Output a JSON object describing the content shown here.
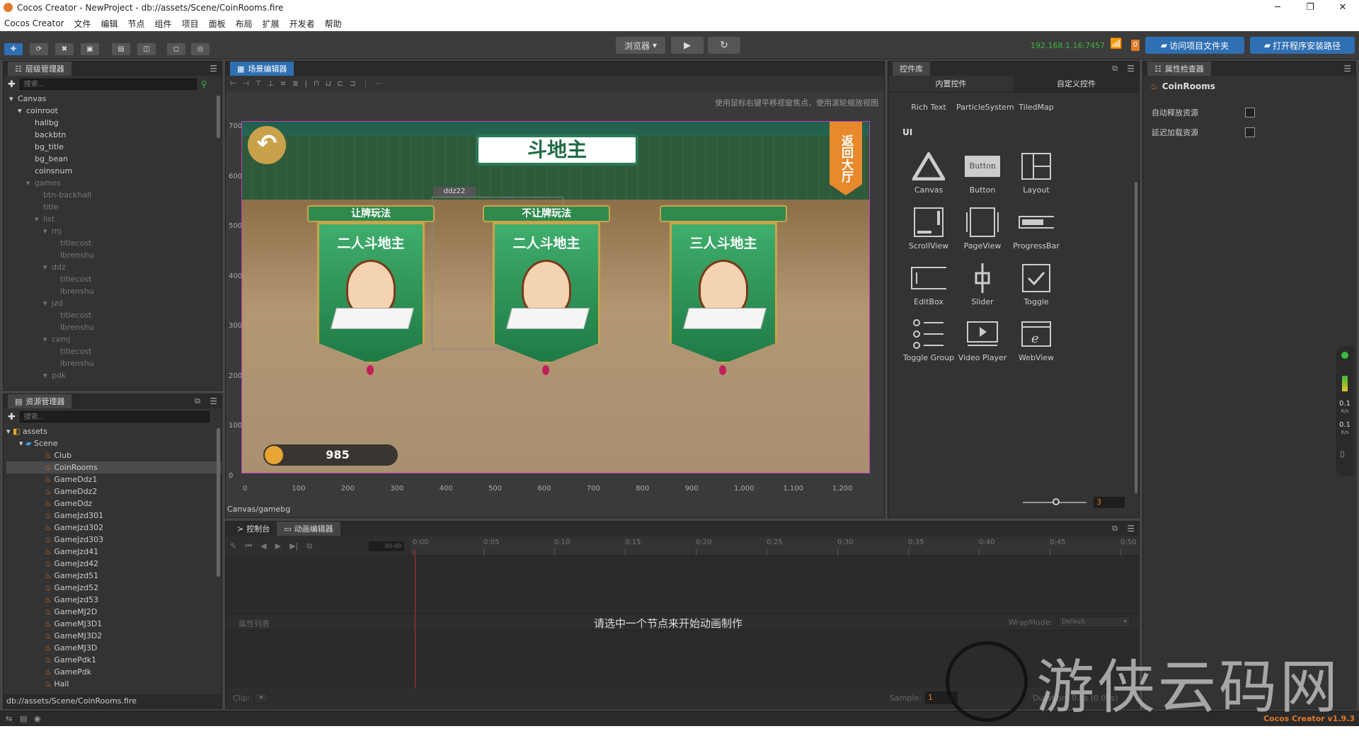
{
  "window": {
    "title": "Cocos Creator - NewProject - db://assets/Scene/CoinRooms.fire",
    "min": "─",
    "max": "❐",
    "close": "✕"
  },
  "menu": [
    "Cocos Creator",
    "文件",
    "编辑",
    "节点",
    "组件",
    "项目",
    "面板",
    "布局",
    "扩展",
    "开发者",
    "帮助"
  ],
  "toolbar": {
    "browser": "浏览器",
    "ip": "192.168.1.16:7457",
    "badge": "0",
    "open_project": "访问项目文件夹",
    "open_install": "打开程序安装路径"
  },
  "hierarchy": {
    "title": "层级管理器",
    "search_placeholder": "搜索...",
    "nodes": [
      {
        "label": "Canvas",
        "depth": 0,
        "arrow": "▾",
        "dim": false
      },
      {
        "label": "coinroot",
        "depth": 1,
        "arrow": "▾",
        "dim": false
      },
      {
        "label": "hallbg",
        "depth": 2,
        "arrow": "",
        "dim": false
      },
      {
        "label": "backbtn",
        "depth": 2,
        "arrow": "",
        "dim": false
      },
      {
        "label": "bg_title",
        "depth": 2,
        "arrow": "",
        "dim": false
      },
      {
        "label": "bg_bean",
        "depth": 2,
        "arrow": "",
        "dim": false
      },
      {
        "label": "coinsnum",
        "depth": 2,
        "arrow": "",
        "dim": false
      },
      {
        "label": "games",
        "depth": 2,
        "arrow": "▾",
        "dim": true
      },
      {
        "label": "btn-backhall",
        "depth": 3,
        "arrow": "",
        "dim": true
      },
      {
        "label": "title",
        "depth": 3,
        "arrow": "",
        "dim": true
      },
      {
        "label": "list",
        "depth": 3,
        "arrow": "▾",
        "dim": true
      },
      {
        "label": "mj",
        "depth": 4,
        "arrow": "▾",
        "dim": true
      },
      {
        "label": "titlecost",
        "depth": 5,
        "arrow": "",
        "dim": true
      },
      {
        "label": "lbrenshu",
        "depth": 5,
        "arrow": "",
        "dim": true
      },
      {
        "label": "ddz",
        "depth": 4,
        "arrow": "▾",
        "dim": true
      },
      {
        "label": "titlecost",
        "depth": 5,
        "arrow": "",
        "dim": true
      },
      {
        "label": "lbrenshu",
        "depth": 5,
        "arrow": "",
        "dim": true
      },
      {
        "label": "jzd",
        "depth": 4,
        "arrow": "▾",
        "dim": true
      },
      {
        "label": "titlecost",
        "depth": 5,
        "arrow": "",
        "dim": true
      },
      {
        "label": "lbrenshu",
        "depth": 5,
        "arrow": "",
        "dim": true
      },
      {
        "label": "cxmj",
        "depth": 4,
        "arrow": "▾",
        "dim": true
      },
      {
        "label": "titlecost",
        "depth": 5,
        "arrow": "",
        "dim": true
      },
      {
        "label": "lbrenshu",
        "depth": 5,
        "arrow": "",
        "dim": true
      },
      {
        "label": "pdk",
        "depth": 4,
        "arrow": "▾",
        "dim": true
      }
    ]
  },
  "assets": {
    "title": "资源管理器",
    "search_placeholder": "搜索...",
    "root": "assets",
    "folder": "Scene",
    "files": [
      "Club",
      "CoinRooms",
      "GameDdz1",
      "GameDdz2",
      "GameDdz",
      "GameJzd301",
      "GameJzd302",
      "GameJzd303",
      "GameJzd41",
      "GameJzd42",
      "GameJzd51",
      "GameJzd52",
      "GameJzd53",
      "GameMJ2D",
      "GameMJ3D1",
      "GameMJ3D2",
      "GameMJ3D",
      "GamePdk1",
      "GamePdk",
      "Hall"
    ],
    "selected": "CoinRooms",
    "path": "db://assets/Scene/CoinRooms.fire"
  },
  "scene": {
    "title": "场景编辑器",
    "hint": "使用鼠标右键平移视窗焦点，使用滚轮缩放视图",
    "path": "Canvas/gamebg",
    "y_ticks": [
      "700",
      "600",
      "500",
      "400",
      "300",
      "200",
      "100",
      "0"
    ],
    "x_ticks": [
      "0",
      "100",
      "200",
      "300",
      "400",
      "500",
      "600",
      "700",
      "800",
      "900",
      "1,000",
      "1,100",
      "1,200"
    ],
    "game": {
      "title": "斗地主",
      "back": "返回大厅",
      "node_tag": "ddz22",
      "coins": "985",
      "cards": [
        {
          "ribbon": "让牌玩法",
          "name": "二人斗地主"
        },
        {
          "ribbon": "不让牌玩法",
          "name": "二人斗地主"
        },
        {
          "ribbon": "",
          "name": "三人斗地主"
        }
      ]
    }
  },
  "widgets": {
    "title": "控件库",
    "tabs": [
      "内置控件",
      "自定义控件"
    ],
    "top_items": [
      "Rich Text",
      "ParticleSystem",
      "TiledMap"
    ],
    "section": "UI",
    "items": [
      "Canvas",
      "Button",
      "Layout",
      "ScrollView",
      "PageView",
      "ProgressBar",
      "EditBox",
      "Slider",
      "Toggle",
      "Toggle Group",
      "Video Player",
      "WebView"
    ],
    "button_text": "Button",
    "zoom": "3"
  },
  "inspector": {
    "title": "属性检查器",
    "node": "CoinRooms",
    "auto_release": "自动释放资源",
    "lazy_load": "延迟加载资源",
    "version": "Cocos Creator v1.9.3"
  },
  "console": {
    "tabs": [
      "控制台",
      "动画编辑器"
    ],
    "time_ticks": [
      "0:00",
      "0:05",
      "0:10",
      "0:15",
      "0:20",
      "0:25",
      "0:30",
      "0:35",
      "0:40",
      "0:45",
      "0:50"
    ],
    "time_display": "00-00",
    "prop_list": "属性列表",
    "message": "请选中一个节点来开始动画制作",
    "wrapmode_label": "WrapMode:",
    "wrapmode_value": "Default",
    "clip_label": "Clip:",
    "sample_label": "Sample:",
    "sample_value": "1",
    "duration": "Duration: 0.0s (0.00s)"
  },
  "net": {
    "up": "0.1",
    "up_unit": "K/s",
    "down": "0.1",
    "down_unit": "K/s"
  },
  "watermark": "游侠云码网"
}
